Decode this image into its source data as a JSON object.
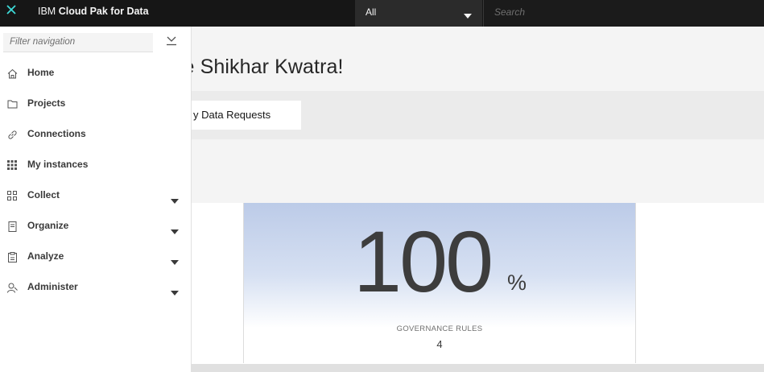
{
  "topbar": {
    "brand_prefix": "IBM",
    "brand_name": "Cloud Pak for Data",
    "scope_value": "All",
    "search_placeholder": "Search"
  },
  "main": {
    "welcome": "come Shikhar Kwatra!",
    "requests_tab": "y Data Requests",
    "stat": {
      "value": "100",
      "unit": "%",
      "label": "GOVERNANCE RULES",
      "count": "4"
    }
  },
  "sidenav": {
    "filter_placeholder": "Filter navigation",
    "items": [
      {
        "label": "Home",
        "icon": "home-icon",
        "expandable": false
      },
      {
        "label": "Projects",
        "icon": "folder-icon",
        "expandable": false
      },
      {
        "label": "Connections",
        "icon": "link-icon",
        "expandable": false
      },
      {
        "label": "My instances",
        "icon": "grid-icon",
        "expandable": false
      },
      {
        "label": "Collect",
        "icon": "collect-icon",
        "expandable": true
      },
      {
        "label": "Organize",
        "icon": "catalog-icon",
        "expandable": true
      },
      {
        "label": "Analyze",
        "icon": "clipboard-icon",
        "expandable": true
      },
      {
        "label": "Administer",
        "icon": "user-admin-icon",
        "expandable": true
      }
    ]
  },
  "colors": {
    "topbar_bg": "#161616",
    "accent_close": "#3ddbd9",
    "stat_gradient_top": "#bccbe8"
  }
}
